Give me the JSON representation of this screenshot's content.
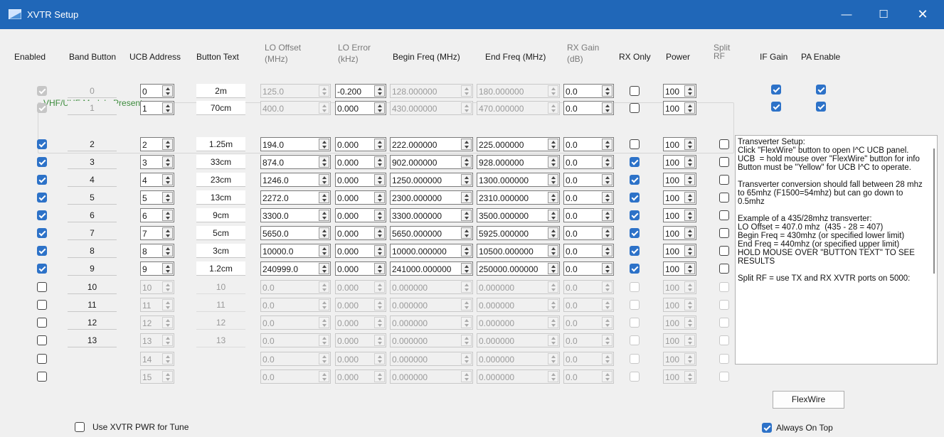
{
  "window": {
    "title": "XVTR Setup",
    "minimize": "—",
    "maximize": "☐",
    "close": "✕",
    "accent": "#2067b8"
  },
  "headers": {
    "enabled": "Enabled",
    "band_button": "Band Button",
    "ucb_address": "UCB Address",
    "button_text": "Button Text",
    "lo_offset_1": "LO Offset",
    "lo_offset_2": "(MHz)",
    "lo_error_1": "LO Error",
    "lo_error_2": "(kHz)",
    "begin_freq": "Begin Freq (MHz)",
    "end_freq": "End Freq (MHz)",
    "rx_gain_1": "RX Gain",
    "rx_gain_2": "(dB)",
    "rx_only": "RX Only",
    "power": "Power",
    "split_rf_1": "Split",
    "split_rf_2": "RF",
    "if_gain": "IF Gain",
    "pa_enable": "PA Enable"
  },
  "vhf_group_label": "VHF/UHF Module Present",
  "rows": [
    {
      "enabled": "dis-checked",
      "band": "0",
      "ucb": "0",
      "text": "2m",
      "lo": "125.0",
      "err": "-0.200",
      "begin": "128.000000",
      "end": "180.000000",
      "gain": "0.0",
      "rxonly": "off",
      "power": "100",
      "split": null,
      "ifgain": true,
      "pa": true,
      "active_lo": false
    },
    {
      "enabled": "dis-checked",
      "band": "1",
      "ucb": "1",
      "text": "70cm",
      "lo": "400.0",
      "err": "0.000",
      "begin": "430.000000",
      "end": "470.000000",
      "gain": "0.0",
      "rxonly": "off",
      "power": "100",
      "split": null,
      "ifgain": true,
      "pa": true,
      "active_lo": false
    },
    {
      "enabled": "checked",
      "band": "2",
      "ucb": "2",
      "text": "1.25m",
      "lo": "194.0",
      "err": "0.000",
      "begin": "222.000000",
      "end": "225.000000",
      "gain": "0.0",
      "rxonly": "off",
      "power": "100",
      "split": "off",
      "active_lo": true
    },
    {
      "enabled": "checked",
      "band": "3",
      "ucb": "3",
      "text": "33cm",
      "lo": "874.0",
      "err": "0.000",
      "begin": "902.000000",
      "end": "928.000000",
      "gain": "0.0",
      "rxonly": "checked",
      "power": "100",
      "split": "off",
      "active_lo": true
    },
    {
      "enabled": "checked",
      "band": "4",
      "ucb": "4",
      "text": "23cm",
      "lo": "1246.0",
      "err": "0.000",
      "begin": "1250.000000",
      "end": "1300.000000",
      "gain": "0.0",
      "rxonly": "checked",
      "power": "100",
      "split": "off",
      "active_lo": true
    },
    {
      "enabled": "checked",
      "band": "5",
      "ucb": "5",
      "text": "13cm",
      "lo": "2272.0",
      "err": "0.000",
      "begin": "2300.000000",
      "end": "2310.000000",
      "gain": "0.0",
      "rxonly": "checked",
      "power": "100",
      "split": "off",
      "active_lo": true
    },
    {
      "enabled": "checked",
      "band": "6",
      "ucb": "6",
      "text": "9cm",
      "lo": "3300.0",
      "err": "0.000",
      "begin": "3300.000000",
      "end": "3500.000000",
      "gain": "0.0",
      "rxonly": "checked",
      "power": "100",
      "split": "off",
      "active_lo": true
    },
    {
      "enabled": "checked",
      "band": "7",
      "ucb": "7",
      "text": "5cm",
      "lo": "5650.0",
      "err": "0.000",
      "begin": "5650.000000",
      "end": "5925.000000",
      "gain": "0.0",
      "rxonly": "checked",
      "power": "100",
      "split": "off",
      "active_lo": true
    },
    {
      "enabled": "checked",
      "band": "8",
      "ucb": "8",
      "text": "3cm",
      "lo": "10000.0",
      "err": "0.000",
      "begin": "10000.000000",
      "end": "10500.000000",
      "gain": "0.0",
      "rxonly": "checked",
      "power": "100",
      "split": "off",
      "active_lo": true
    },
    {
      "enabled": "checked",
      "band": "9",
      "ucb": "9",
      "text": "1.2cm",
      "lo": "240999.0",
      "err": "0.000",
      "begin": "241000.000000",
      "end": "250000.000000",
      "gain": "0.0",
      "rxonly": "checked",
      "power": "100",
      "split": "off",
      "active_lo": true
    },
    {
      "enabled": "off",
      "band": "10",
      "ucb": "10",
      "text": "10",
      "lo": "0.0",
      "err": "0.000",
      "begin": "0.000000",
      "end": "0.000000",
      "gain": "0.0",
      "rxonly": "disabled",
      "power": "100",
      "split": "disabled",
      "active_lo": false
    },
    {
      "enabled": "off",
      "band": "11",
      "ucb": "11",
      "text": "11",
      "lo": "0.0",
      "err": "0.000",
      "begin": "0.000000",
      "end": "0.000000",
      "gain": "0.0",
      "rxonly": "disabled",
      "power": "100",
      "split": "disabled",
      "active_lo": false
    },
    {
      "enabled": "off",
      "band": "12",
      "ucb": "12",
      "text": "12",
      "lo": "0.0",
      "err": "0.000",
      "begin": "0.000000",
      "end": "0.000000",
      "gain": "0.0",
      "rxonly": "disabled",
      "power": "100",
      "split": "disabled",
      "active_lo": false
    },
    {
      "enabled": "off",
      "band": "13",
      "ucb": "13",
      "text": "13",
      "lo": "0.0",
      "err": "0.000",
      "begin": "0.000000",
      "end": "0.000000",
      "gain": "0.0",
      "rxonly": "disabled",
      "power": "100",
      "split": "disabled",
      "active_lo": false
    },
    {
      "enabled": "off",
      "band": null,
      "ucb": "14",
      "text": null,
      "lo": "0.0",
      "err": "0.000",
      "begin": "0.000000",
      "end": "0.000000",
      "gain": "0.0",
      "rxonly": "disabled",
      "power": "100",
      "split": "disabled",
      "active_lo": false
    },
    {
      "enabled": "off",
      "band": null,
      "ucb": "15",
      "text": null,
      "lo": "0.0",
      "err": "0.000",
      "begin": "0.000000",
      "end": "0.000000",
      "gain": "0.0",
      "rxonly": "disabled",
      "power": "100",
      "split": "disabled",
      "active_lo": false
    }
  ],
  "info_text": "Transverter Setup:\nClick \"FlexWire\" button to open I^C UCB panel.\nUCB  = hold mouse over \"FlexWire\" button for info\nButton must be \"Yellow\" for UCB I^C to operate.\n\nTransverter conversion should fall between 28 mhz to 65mhz (F1500=54mhz) but can go down to 0.5mhz\n\nExample of a 435/28mhz transverter:\nLO Offset = 407.0 mhz  (435 - 28 = 407)\nBegin Freq = 430mhz (or specified lower limit)\nEnd Freq = 440mhz (or specified upper limit)\nHOLD MOUSE OVER \"BUTTON TEXT\" TO SEE RESULTS\n\nSplit RF = use TX and RX XVTR ports on 5000:",
  "flexwire_button": "FlexWire",
  "use_xvtr_pwr": {
    "label": "Use XVTR PWR for Tune",
    "checked": false
  },
  "always_on_top": {
    "label": "Always On Top",
    "checked": true
  }
}
